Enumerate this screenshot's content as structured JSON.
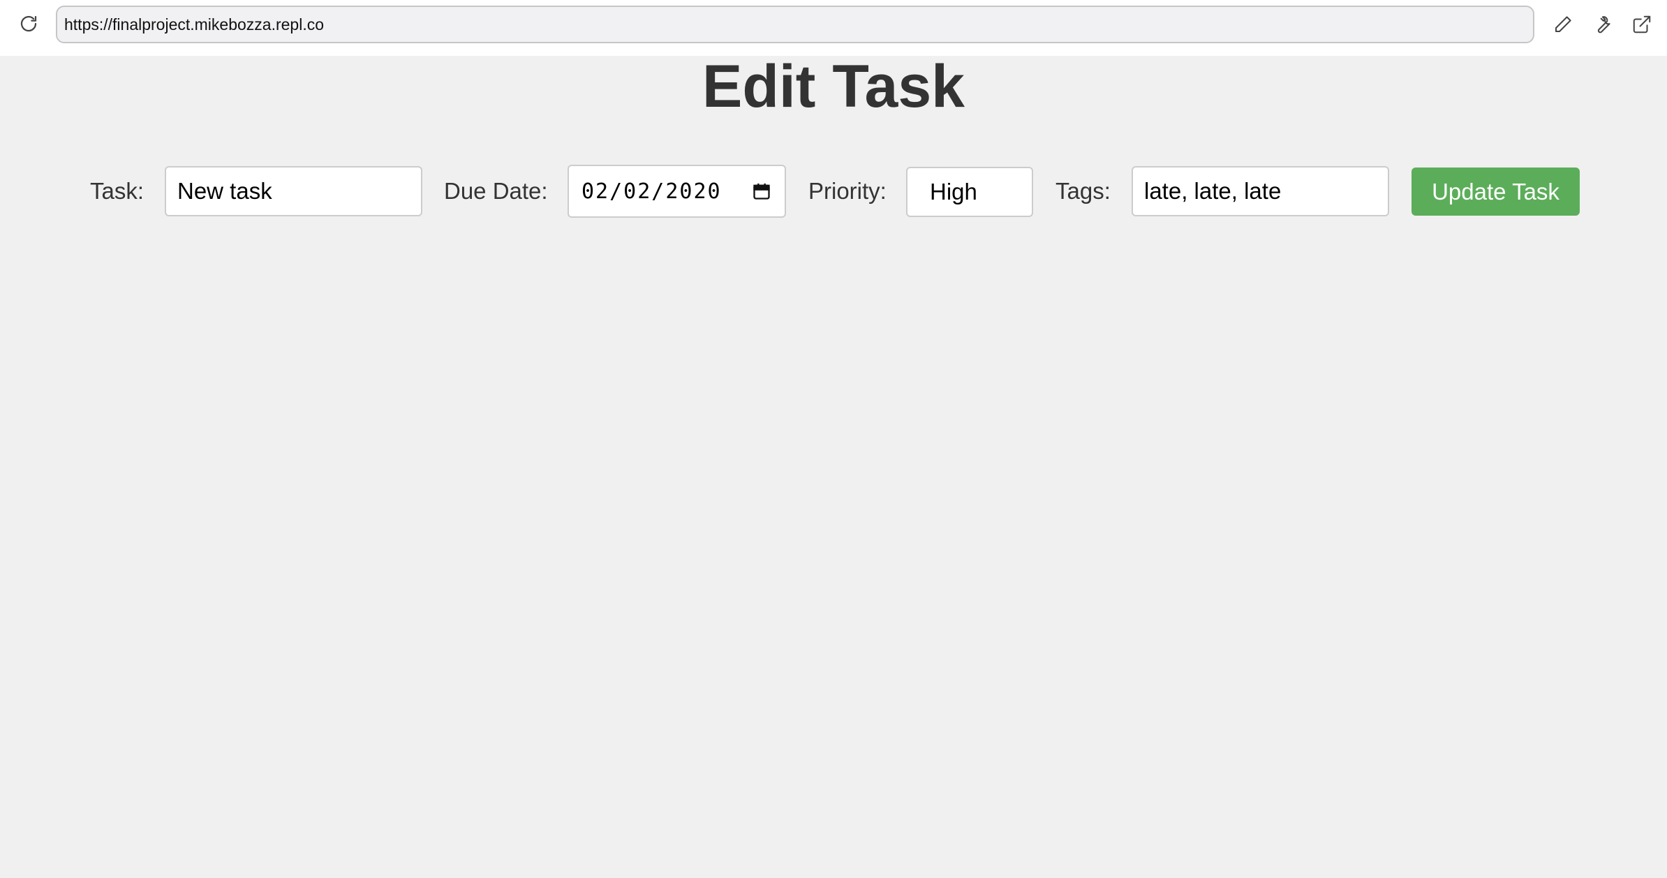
{
  "browser": {
    "url": "https://finalproject.mikebozza.repl.co",
    "icons": {
      "reload": "reload-icon",
      "edit": "pencil-icon",
      "tools": "wrench-icon",
      "external": "external-link-icon"
    }
  },
  "page": {
    "title": "Edit Task"
  },
  "form": {
    "task_label": "Task:",
    "task_value": "New task",
    "due_date_label": "Due Date:",
    "due_date_value": "02/02/2020",
    "priority_label": "Priority:",
    "priority_value": "High",
    "tags_label": "Tags:",
    "tags_value": "late, late, late",
    "submit_label": "Update Task"
  },
  "colors": {
    "background": "#f0f0f0",
    "button": "#5cad5a",
    "title_text": "#333333"
  }
}
